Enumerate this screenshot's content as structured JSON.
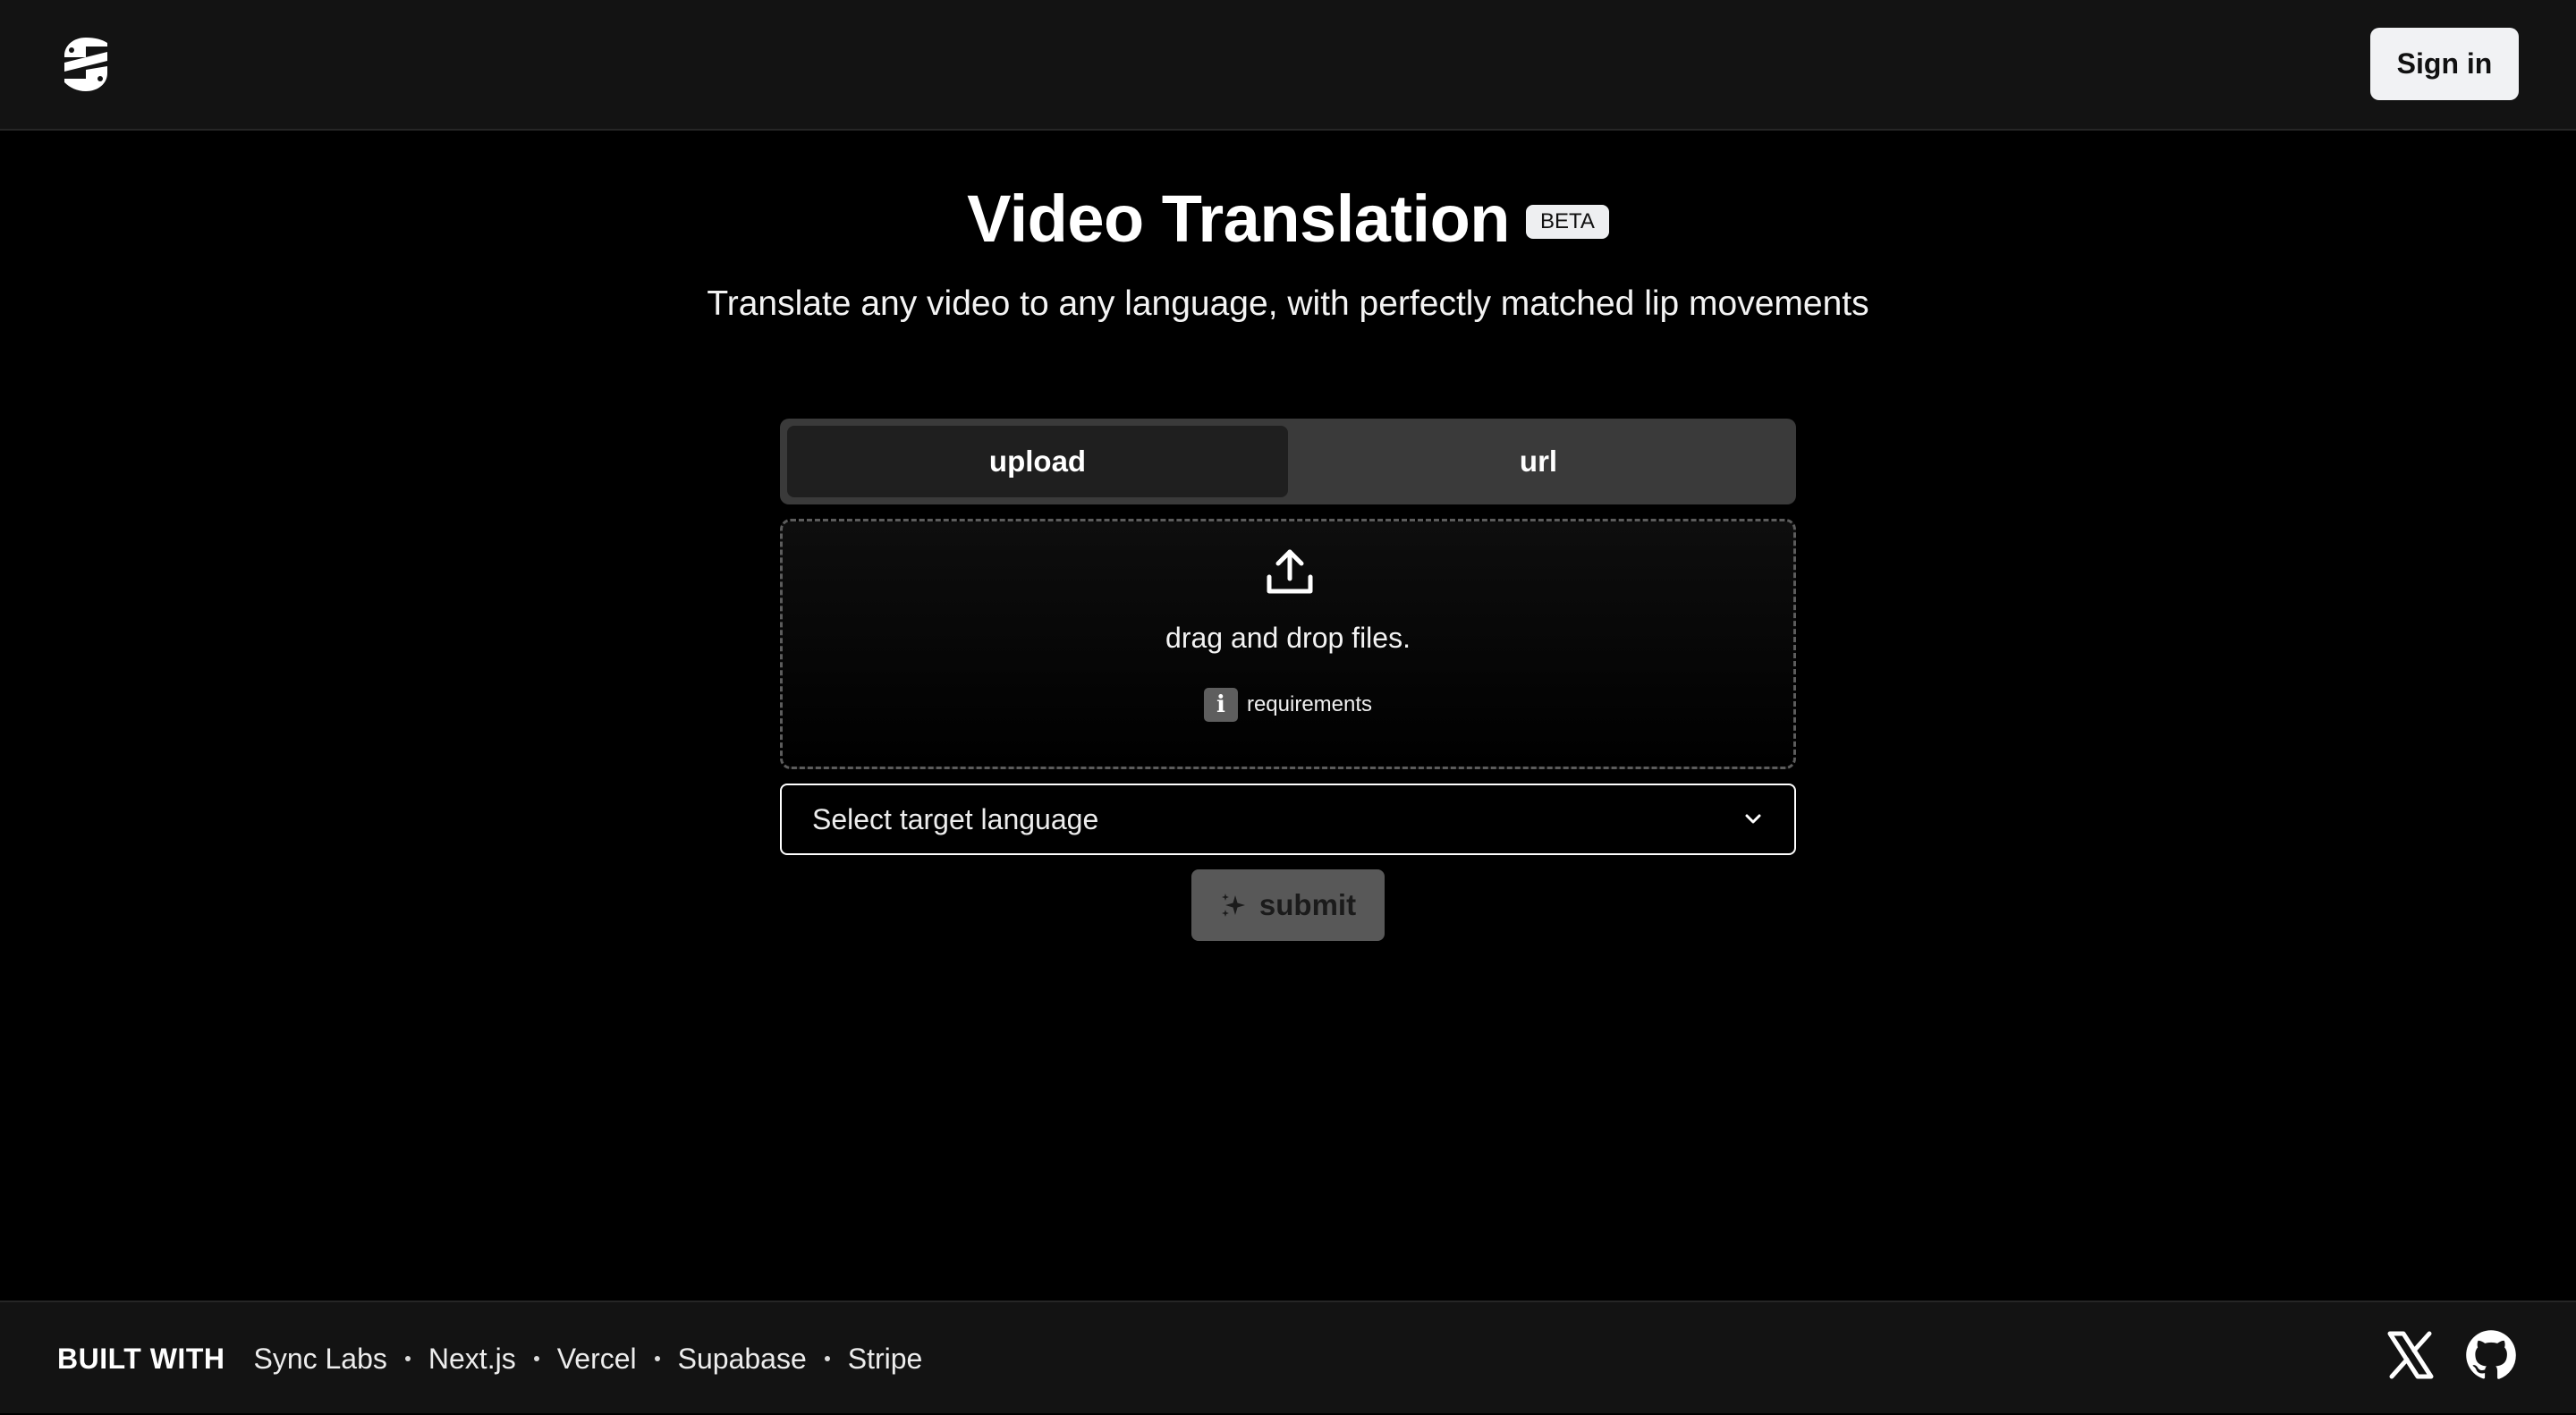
{
  "header": {
    "logo_icon": "sync-labs-logo-icon",
    "signin_label": "Sign in"
  },
  "hero": {
    "title": "Video Translation",
    "badge": "BETA",
    "subtitle": "Translate any video to any language, with perfectly matched lip movements"
  },
  "tabs": [
    {
      "label": "upload",
      "active": true
    },
    {
      "label": "url",
      "active": false
    }
  ],
  "dropzone": {
    "icon": "upload-icon",
    "text": "drag and drop files.",
    "info_icon": "info-icon",
    "requirements_label": "requirements"
  },
  "language_select": {
    "placeholder": "Select target language",
    "icon": "chevron-down-icon"
  },
  "submit": {
    "label": "submit",
    "icon": "sparkle-icon",
    "disabled": true
  },
  "footer": {
    "built_with_label": "BUILT WITH",
    "tech": [
      "Sync Labs",
      "Next.js",
      "Vercel",
      "Supabase",
      "Stripe"
    ],
    "social": [
      "x-icon",
      "github-icon"
    ]
  },
  "colors": {
    "background": "#000000",
    "header_bg": "#131313",
    "signin_bg": "#f1f2f4",
    "tabs_bg": "#3a3a3a",
    "tab_active_bg": "#1f1f1f",
    "submit_bg": "#585858"
  }
}
